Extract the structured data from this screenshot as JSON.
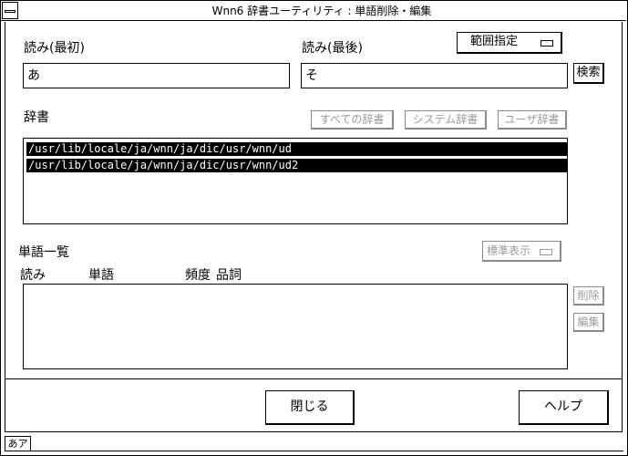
{
  "window": {
    "title": "Wnn6 辞書ユーティリティ : 単語削除・編集"
  },
  "reading_first": {
    "label": "読み(最初)",
    "value": "あ"
  },
  "reading_last": {
    "label": "読み(最後)",
    "value": "そ"
  },
  "range_button": {
    "label": "範囲指定"
  },
  "search_button": {
    "label": "検索"
  },
  "dictionary": {
    "label": "辞書",
    "buttons": {
      "all": "すべての辞書",
      "system": "システム辞書",
      "user": "ユーザ辞書"
    },
    "items": [
      "/usr/lib/locale/ja/wnn/ja/dic/usr/wnn/ud",
      "/usr/lib/locale/ja/wnn/ja/dic/usr/wnn/ud2"
    ]
  },
  "word_list": {
    "label": "単語一覧",
    "display_button": "標準表示",
    "columns": [
      "読み",
      "単語",
      "頻度",
      "品詞"
    ]
  },
  "side_buttons": {
    "delete": "削除",
    "edit": "編集"
  },
  "bottom_buttons": {
    "close": "閉じる",
    "help": "ヘルプ"
  },
  "status": {
    "mode": "あア"
  }
}
